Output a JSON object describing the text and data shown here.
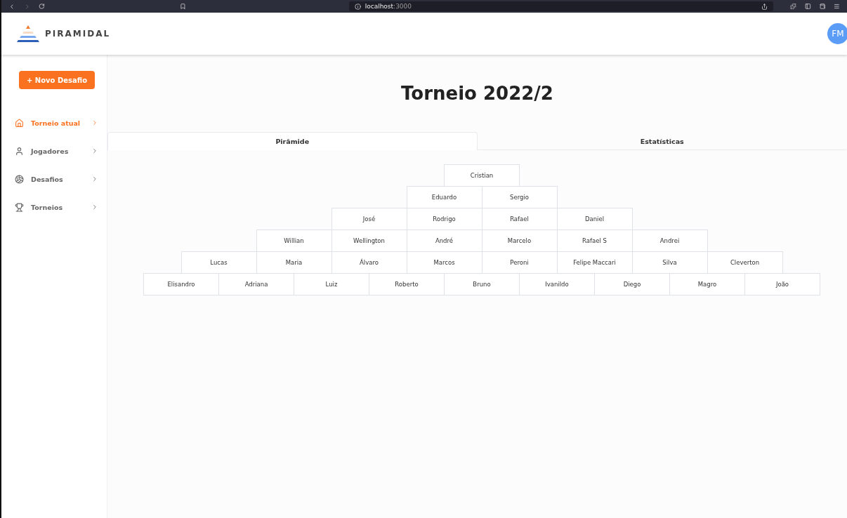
{
  "browser": {
    "host": "localhost",
    "port": ":3000"
  },
  "header": {
    "brand": "PIRAMIDAL",
    "avatar": "FM"
  },
  "sidebar": {
    "new_button": "+ Novo Desafio",
    "items": [
      {
        "label": "Torneio atual",
        "selected": true
      },
      {
        "label": "Jogadores",
        "selected": false
      },
      {
        "label": "Desafios",
        "selected": false
      },
      {
        "label": "Torneios",
        "selected": false
      }
    ]
  },
  "title": "Torneio 2022/2",
  "tabs": [
    {
      "label": "Pirâmide",
      "selected": true
    },
    {
      "label": "Estatísticas",
      "selected": false
    }
  ],
  "pyramid": [
    [
      "Cristian"
    ],
    [
      "Eduardo",
      "Sergio"
    ],
    [
      "José",
      "Rodrigo",
      "Rafael",
      "Daniel"
    ],
    [
      "Willian",
      "Wellington",
      "André",
      "Marcelo",
      "Rafael S",
      "Andrei"
    ],
    [
      "Lucas",
      "Maria",
      "Álvaro",
      "Marcos",
      "Peroni",
      "Felipe Maccari",
      "Silva",
      "Cleverton"
    ],
    [
      "Elisandro",
      "Adriana",
      "Luiz",
      "Roberto",
      "Bruno",
      "Ivanildo",
      "Diego",
      "Magro",
      "João"
    ]
  ]
}
